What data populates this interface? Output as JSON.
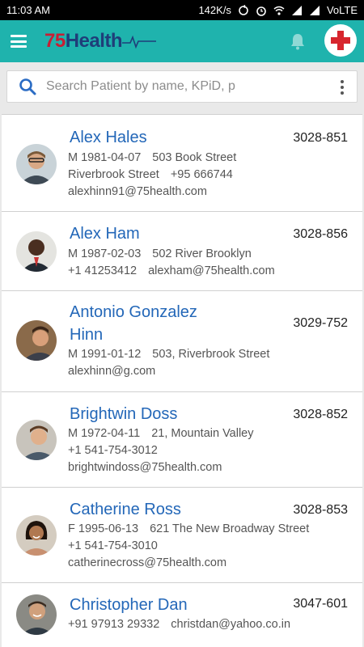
{
  "status_bar": {
    "time": "11:03 AM",
    "speed": "142K/s",
    "network": "VoLTE"
  },
  "app_bar": {
    "logo_prefix": "75",
    "logo_word": "Health",
    "menu_icon": "hamburger-icon",
    "notification_icon": "bell-icon",
    "emergency_icon": "red-cross-icon"
  },
  "search": {
    "placeholder": "Search Patient by name, KPiD, p"
  },
  "patients": [
    {
      "name": "Alex Hales",
      "pid": "3028-851",
      "line1": "M 1981-04-07",
      "line1b": "503 Book Street",
      "line2": "Riverbrook Street",
      "line2b": "+95 666744",
      "line3": "alexhinn91@75health.com",
      "line3b": ""
    },
    {
      "name": "Alex Ham",
      "pid": "3028-856",
      "line1": "M 1987-02-03",
      "line1b": "502 River Brooklyn",
      "line2": "+1 41253412",
      "line2b": "alexham@75health.com",
      "line3": "",
      "line3b": ""
    },
    {
      "name": "Antonio Gonzalez",
      "name2": "Hinn",
      "pid": "3029-752",
      "line1": "M 1991-01-12",
      "line1b": "503, Riverbrook Street",
      "line2": "alexhinn@g.com",
      "line2b": "",
      "line3": "",
      "line3b": ""
    },
    {
      "name": "Brightwin Doss",
      "pid": "3028-852",
      "line1": "M 1972-04-11",
      "line1b": "21, Mountain Valley",
      "line2": "+1 541-754-3012",
      "line2b": "",
      "line3": "brightwindoss@75health.com",
      "line3b": ""
    },
    {
      "name": "Catherine Ross",
      "pid": "3028-853",
      "line1": "F 1995-06-13",
      "line1b": "621   The New Broadway Street",
      "line2": "+1 541-754-3010",
      "line2b": "",
      "line3": "catherinecross@75health.com",
      "line3b": ""
    },
    {
      "name": "Christopher Dan",
      "pid": "3047-601",
      "line1": "+91 97913 29332",
      "line1b": "christdan@yahoo.co.in",
      "line2": "",
      "line2b": "",
      "line3": "",
      "line3b": ""
    }
  ],
  "colors": {
    "app_bar": "#1fb3ad",
    "name_link": "#2367b8",
    "logo_red": "#c81e34",
    "logo_navy": "#1f3e79"
  }
}
